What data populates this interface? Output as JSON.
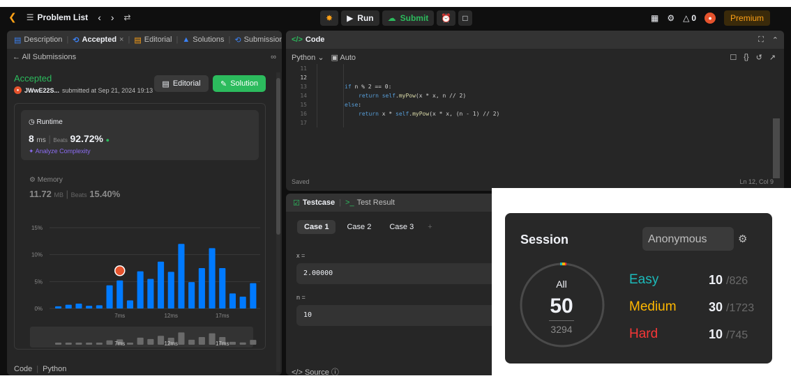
{
  "topbar": {
    "problem_list": "Problem List",
    "run": "Run",
    "submit": "Submit",
    "streak": "0",
    "premium": "Premium",
    "icons": [
      "leetcode-logo",
      "list-icon",
      "chevron-left-icon",
      "chevron-right-icon",
      "shuffle-icon",
      "debug-icon",
      "play-icon",
      "cloud-upload-icon",
      "alarm-icon",
      "note-icon",
      "grid-icon",
      "settings-icon",
      "fire-icon",
      "avatar-icon"
    ]
  },
  "left": {
    "tabs": [
      "Description",
      "Accepted",
      "Editorial",
      "Solutions",
      "Submissions"
    ],
    "all_submissions": "All Submissions",
    "status": "Accepted",
    "user": "JWwE22S...",
    "submitted": "submitted at Sep 21, 2024 19:13",
    "editorial_btn": "Editorial",
    "solution_btn": "Solution",
    "runtime": {
      "label": "Runtime",
      "value": "8",
      "unit": "ms",
      "beats_label": "Beats",
      "beats": "92.72%",
      "analyze": "Analyze Complexity"
    },
    "memory": {
      "label": "Memory",
      "value": "11.72",
      "unit": "MB",
      "beats_label": "Beats",
      "beats": "15.40%"
    },
    "footer": [
      "Code",
      "Python"
    ]
  },
  "chart_data": {
    "type": "bar",
    "title": "",
    "ylabel": "",
    "xlabel": "",
    "ylim": [
      0,
      15
    ],
    "yticks": [
      "15%",
      "10%",
      "5%",
      "0%"
    ],
    "xticks": [
      {
        "at": 6,
        "label": "7ms"
      },
      {
        "at": 11,
        "label": "12ms"
      },
      {
        "at": 16,
        "label": "17ms"
      }
    ],
    "values": [
      0.4,
      0.7,
      0.9,
      0.5,
      0.6,
      4.3,
      5.2,
      1.5,
      6.9,
      5.5,
      8.7,
      6.8,
      12.0,
      4.9,
      7.5,
      11.2,
      7.5,
      2.8,
      2.2,
      4.7
    ],
    "highlight_index": 6,
    "bar_color": "#007aff",
    "grid": true
  },
  "code": {
    "title": "Code",
    "language": "Python",
    "mode": "Auto",
    "lines": [
      {
        "n": "11",
        "t": ""
      },
      {
        "n": "12",
        "t": ""
      },
      {
        "n": "13",
        "t": "if n % 2 == 0:",
        "indent": 0
      },
      {
        "n": "14",
        "t": "return self.myPow(x * x, n // 2)",
        "indent": 1
      },
      {
        "n": "15",
        "t": "else:",
        "indent": 0
      },
      {
        "n": "16",
        "t": "return x * self.myPow(x * x, (n - 1) // 2)",
        "indent": 1
      },
      {
        "n": "17",
        "t": ""
      }
    ],
    "saved": "Saved",
    "position": "Ln 12, Col 9"
  },
  "test": {
    "tab_testcase": "Testcase",
    "tab_result": "Test Result",
    "cases": [
      "Case 1",
      "Case 2",
      "Case 3"
    ],
    "plus": "+",
    "x_label": "x =",
    "x_value": "2.00000",
    "n_label": "n =",
    "n_value": "10",
    "source": "Source"
  },
  "session": {
    "title": "Session",
    "selector": "Anonymous",
    "all_label": "All",
    "solved": "50",
    "total": "3294",
    "easy": {
      "label": "Easy",
      "count": "10",
      "total": "/826",
      "color": "#1cbaba"
    },
    "medium": {
      "label": "Medium",
      "count": "30",
      "total": "/1723",
      "color": "#ffb700"
    },
    "hard": {
      "label": "Hard",
      "count": "10",
      "total": "/745",
      "color": "#f63737"
    }
  }
}
